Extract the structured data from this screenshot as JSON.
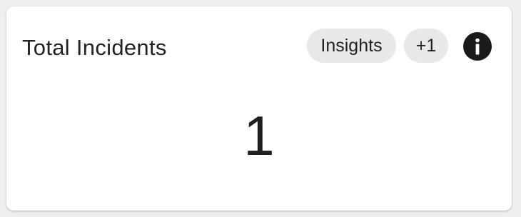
{
  "card": {
    "title": "Total Incidents",
    "chips": [
      {
        "label": "Insights"
      },
      {
        "label": "+1"
      }
    ],
    "info_icon": "info-icon",
    "value": "1"
  },
  "colors": {
    "background": "#efefef",
    "card": "#ffffff",
    "chip": "#e9e9e9",
    "text": "#222222",
    "icon": "#1a1a1a"
  }
}
